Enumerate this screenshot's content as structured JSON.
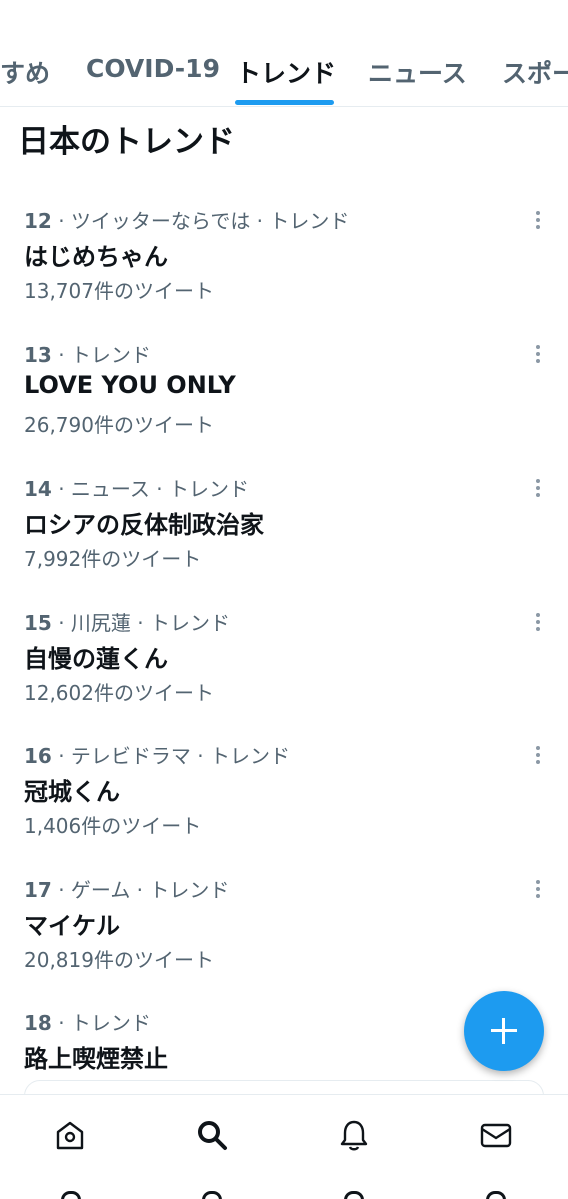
{
  "tabs": [
    {
      "label": "すめ"
    },
    {
      "label": "COVID-19"
    },
    {
      "label": "トレンド",
      "active": true
    },
    {
      "label": "ニュース"
    },
    {
      "label": "スポー"
    }
  ],
  "section_title": "日本のトレンド",
  "trends": [
    {
      "rank": "12",
      "context": "ツイッターならでは · トレンド",
      "name": "はじめちゃん",
      "count": "13,707件のツイート"
    },
    {
      "rank": "13",
      "context": "トレンド",
      "name": "LOVE YOU ONLY",
      "count": "26,790件のツイート"
    },
    {
      "rank": "14",
      "context": "ニュース · トレンド",
      "name": "ロシアの反体制政治家",
      "count": "7,992件のツイート"
    },
    {
      "rank": "15",
      "context": "川尻蓮 · トレンド",
      "name": "自慢の蓮くん",
      "count": "12,602件のツイート"
    },
    {
      "rank": "16",
      "context": "テレビドラマ · トレンド",
      "name": "冠城くん",
      "count": "1,406件のツイート"
    },
    {
      "rank": "17",
      "context": "ゲーム · トレンド",
      "name": "マイケル",
      "count": "20,819件のツイート"
    },
    {
      "rank": "18",
      "context": "トレンド",
      "name": "路上喫煙禁止",
      "count": ""
    }
  ],
  "colors": {
    "accent": "#1d9bf0",
    "secondary_text": "#536471",
    "primary_text": "#0f1419"
  },
  "icons": {
    "fab": "plus-icon",
    "nav": [
      "home-icon",
      "search-icon",
      "bell-icon",
      "mail-icon"
    ]
  }
}
